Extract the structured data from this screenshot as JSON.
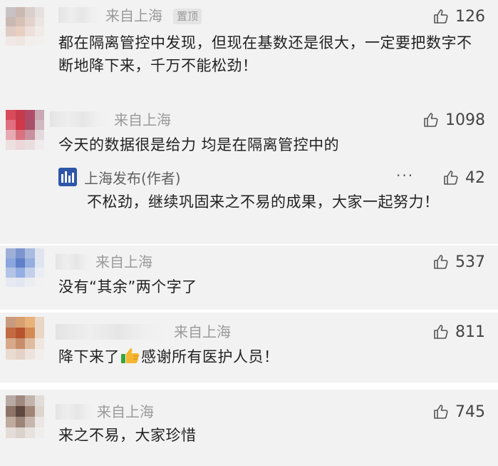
{
  "comments": [
    {
      "location": "来自上海",
      "pinned": "置顶",
      "likes": "126",
      "text": "都在隔离管控中发现，但现在基数还是很大，一定要把数字不断地降下来，千万不能松劲！"
    },
    {
      "location": "来自上海",
      "likes": "1098",
      "text": "今天的数据很是给力 均是在隔离管控中的",
      "reply": {
        "author": "上海发布(作者)",
        "more": "···",
        "likes": "42",
        "text": "不松劲，继续巩固来之不易的成果，大家一起努力！"
      }
    },
    {
      "location": "来自上海",
      "likes": "537",
      "text": "没有“其余”两个字了"
    },
    {
      "location": "来自上海",
      "likes": "811",
      "text_before": "降下来了",
      "emoji": "thumbs-up",
      "text_after": "感谢所有医护人员！"
    },
    {
      "location": "来自上海",
      "likes": "745",
      "text": "来之不易，大家珍惜"
    }
  ],
  "colors": {
    "card_bg": "#f2f2f2",
    "meta_gray": "#9a9a9a",
    "official_blue": "#2d56a8"
  },
  "icons": {
    "like": "thumbs-up-outline-icon",
    "more": "ellipsis-icon"
  }
}
